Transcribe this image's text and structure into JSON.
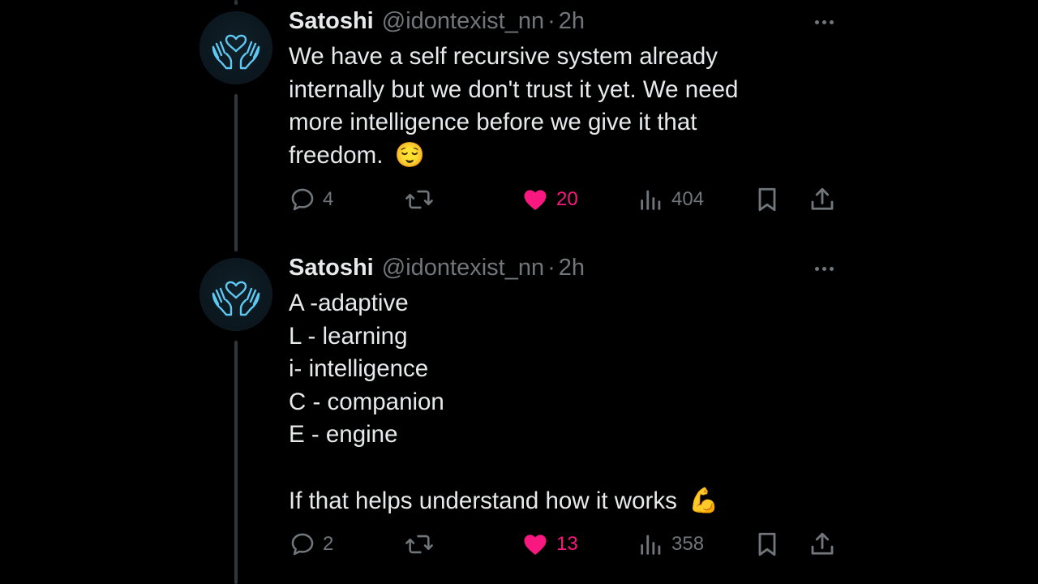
{
  "colors": {
    "background": "#000000",
    "text_primary": "#e7e9ea",
    "text_secondary": "#71767b",
    "like_active": "#f91880",
    "avatar_glow": "#5ec8f2"
  },
  "tweets": [
    {
      "author_name": "Satoshi",
      "handle": "@idontexist_nn",
      "separator": "·",
      "time": "2h",
      "avatar_icon": "heart-hands-icon",
      "lines": [
        "We have a self recursive system already",
        "internally but we don't trust it yet. We need",
        "more intelligence before we give it that",
        "freedom."
      ],
      "end_emoji": "😌",
      "replies": "4",
      "retweets": "",
      "likes": "20",
      "views": "404",
      "liked": true
    },
    {
      "author_name": "Satoshi",
      "handle": "@idontexist_nn",
      "separator": "·",
      "time": "2h",
      "avatar_icon": "heart-hands-icon",
      "lines": [
        "A -adaptive",
        "L - learning",
        "i- intelligence",
        "C - companion",
        "E - engine",
        "",
        "If that helps understand how it works"
      ],
      "end_emoji": "💪",
      "replies": "2",
      "retweets": "",
      "likes": "13",
      "views": "358",
      "liked": true
    }
  ]
}
